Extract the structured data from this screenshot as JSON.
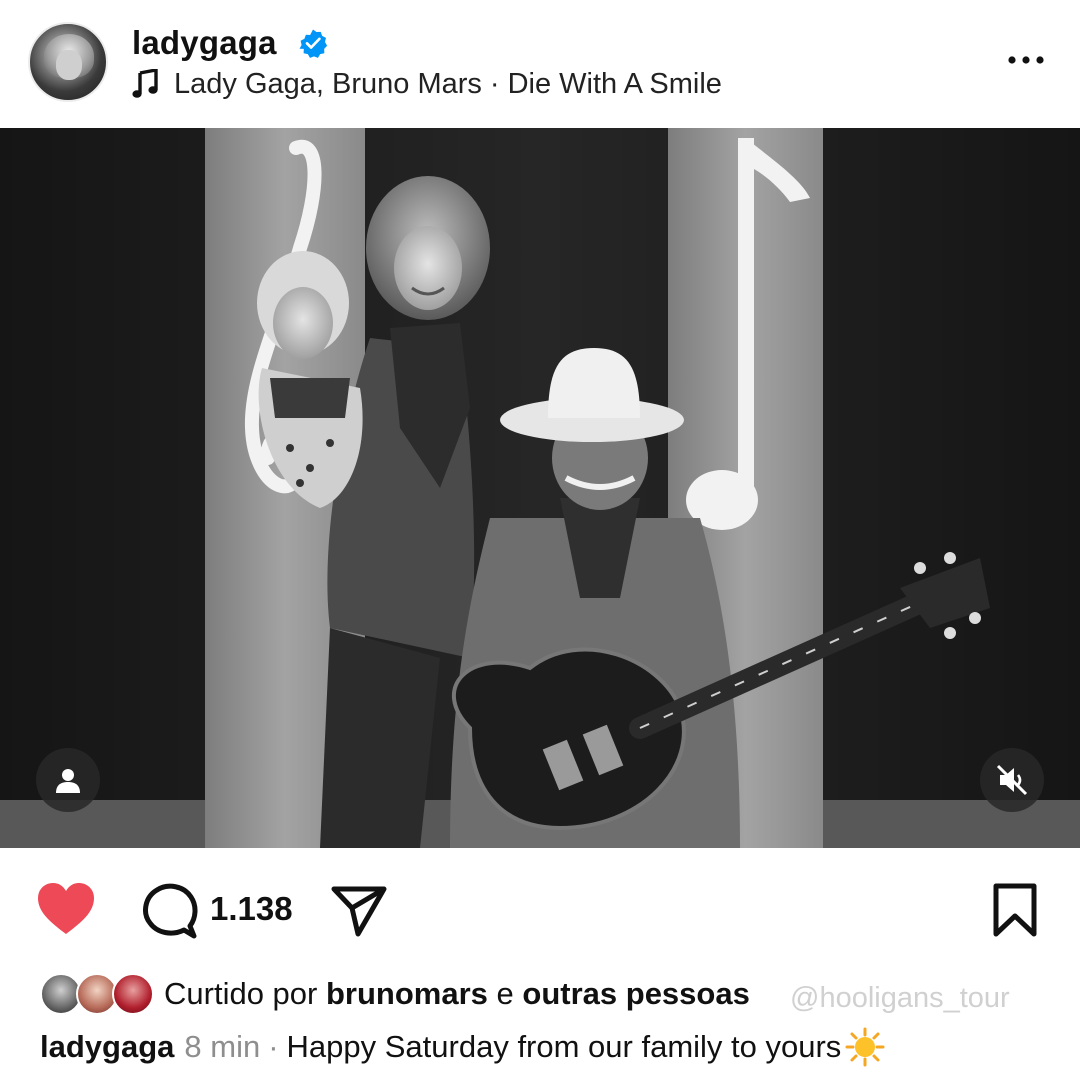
{
  "header": {
    "username": "ladygaga",
    "verified": true,
    "music": {
      "artists": "Lady Gaga, Bruno Mars",
      "separator": "·",
      "song": "Die With A Smile"
    }
  },
  "post": {
    "media_type": "photo",
    "icons": {
      "tag": "person-icon",
      "audio": "muted-speaker-icon"
    }
  },
  "actions": {
    "liked": true,
    "like_color": "#ed4956",
    "comment_count": "1.138"
  },
  "likes": {
    "prefix": "Curtido por",
    "user": "brunomars",
    "connector": "e",
    "others": "outras pessoas"
  },
  "caption": {
    "username": "ladygaga",
    "time": "8 min",
    "separator": "·",
    "text": "Happy Saturday from our family to yours",
    "emoji": "sun"
  },
  "watermark": "@hooligans_tour"
}
